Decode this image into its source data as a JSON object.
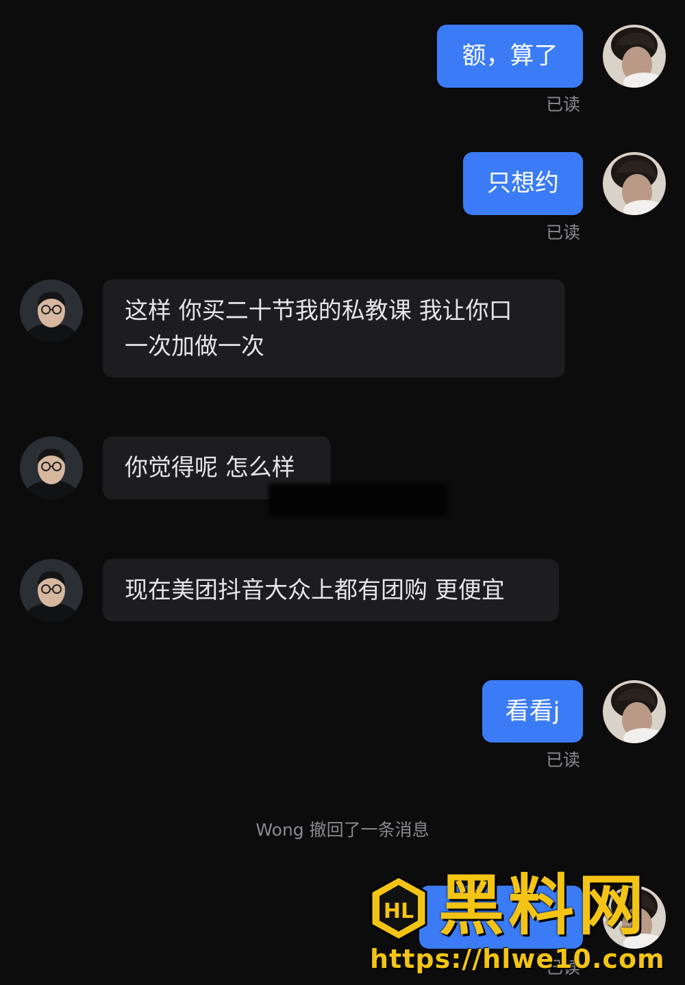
{
  "messages": {
    "m1": {
      "text": "额，算了",
      "status": "已读"
    },
    "m2": {
      "text": "只想约",
      "status": "已读"
    },
    "m3": {
      "line1": "这样 你买二十节我的私教课 我让你口",
      "line2": "一次加做一次"
    },
    "m4": {
      "text": "你觉得呢 怎么样"
    },
    "m5": {
      "text": "现在美团抖音大众上都有团购 更便宜"
    },
    "m6": {
      "text": "看看j",
      "status": "已读"
    },
    "m7": {
      "status": "已读"
    }
  },
  "system": {
    "recall_note": "Wong 撤回了一条消息"
  },
  "watermark": {
    "logo_letters": "HL",
    "title": "黑料网",
    "url": "https://hlwe10.com"
  },
  "colors": {
    "background": "#0c0c0d",
    "outgoing_bubble": "#3b7cf6",
    "incoming_bubble": "#1d1d20",
    "watermark": "#f3c415"
  }
}
